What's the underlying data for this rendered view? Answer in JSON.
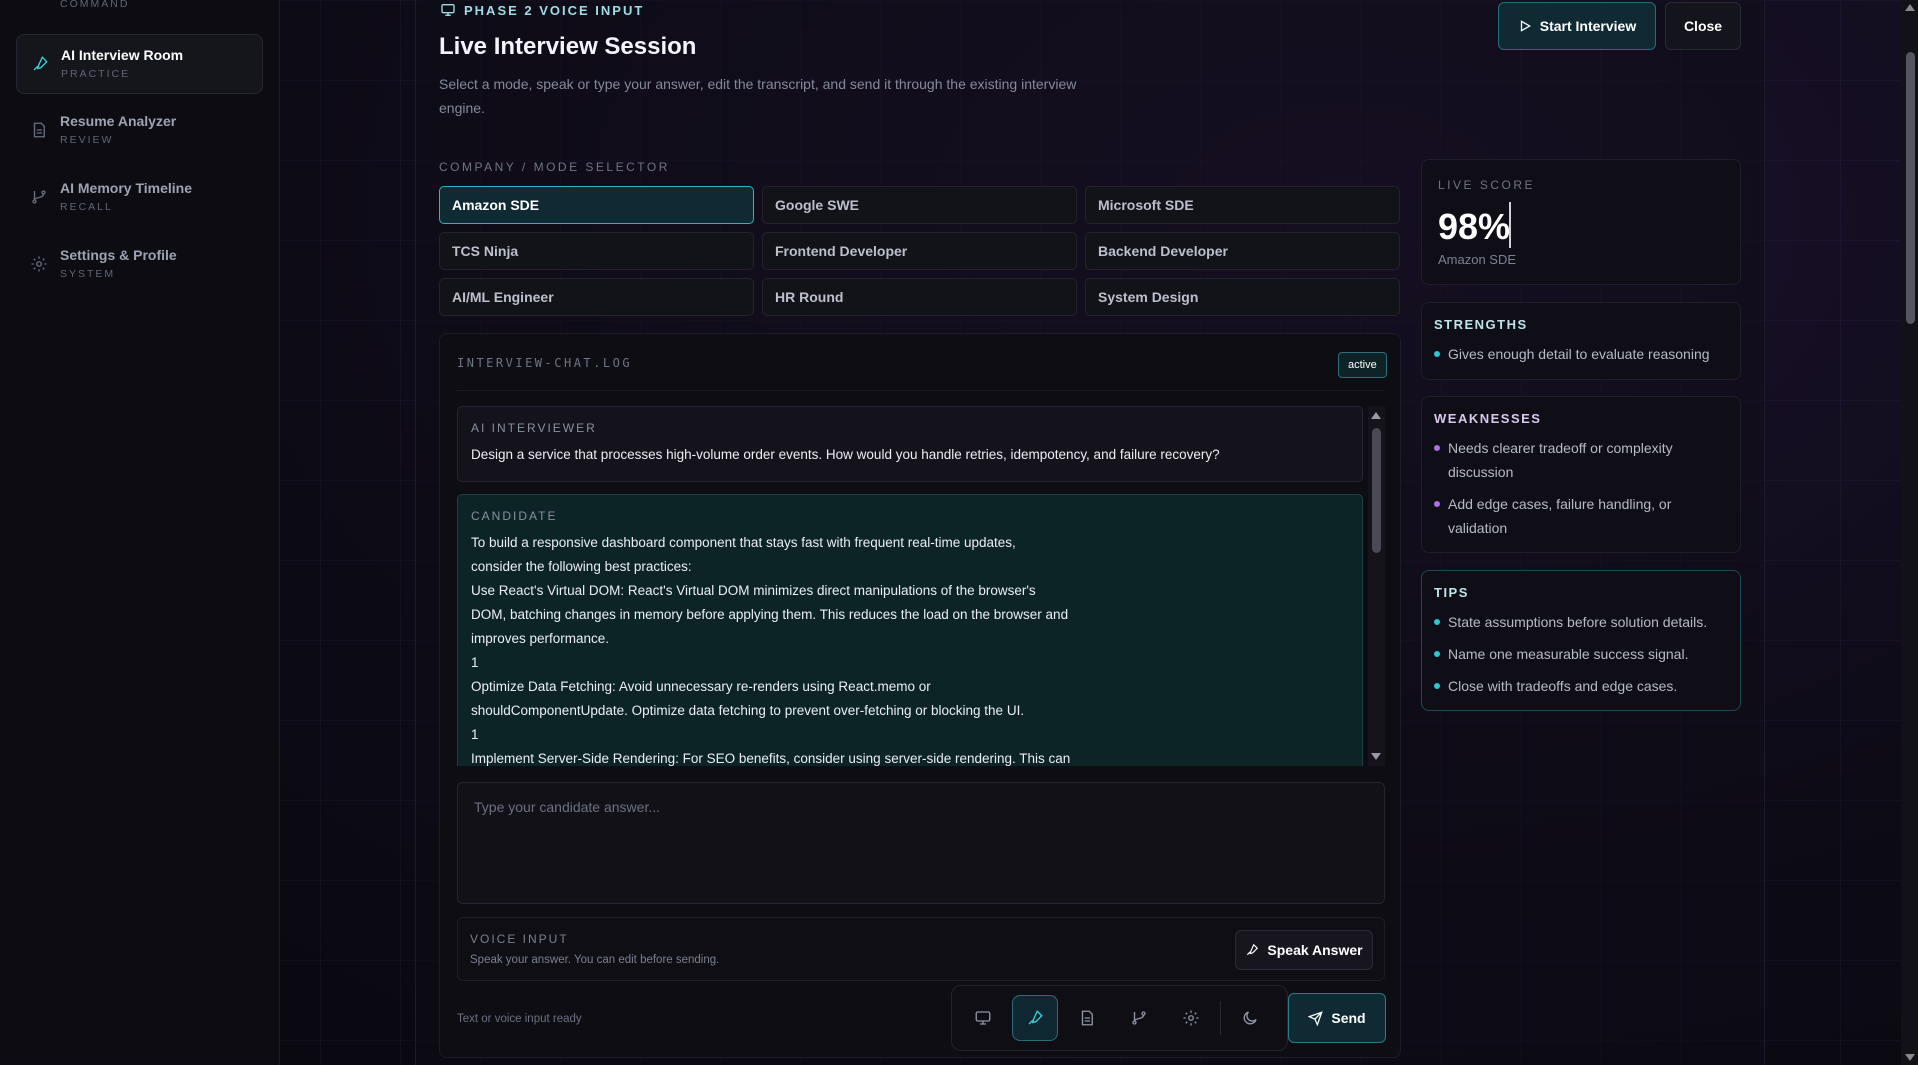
{
  "sidebar": {
    "items": [
      {
        "label": "",
        "sub": "COMMAND"
      },
      {
        "label": "AI Interview Room",
        "sub": "PRACTICE"
      },
      {
        "label": "Resume Analyzer",
        "sub": "REVIEW"
      },
      {
        "label": "AI Memory Timeline",
        "sub": "RECALL"
      },
      {
        "label": "Settings & Profile",
        "sub": "SYSTEM"
      }
    ]
  },
  "header": {
    "phase": "PHASE 2 VOICE INPUT",
    "title": "Live Interview Session",
    "subtitle": "Select a mode, speak or type your answer, edit the transcript, and send it through the existing interview engine.",
    "start_label": "Start Interview",
    "close_label": "Close"
  },
  "modes": {
    "label": "COMPANY / MODE SELECTOR",
    "selected": "Amazon SDE",
    "options": [
      "Amazon SDE",
      "Google SWE",
      "Microsoft SDE",
      "TCS Ninja",
      "Frontend Developer",
      "Backend Developer",
      "AI/ML Engineer",
      "HR Round",
      "System Design"
    ]
  },
  "chat": {
    "log_title": "INTERVIEW-CHAT.LOG",
    "status_badge": "active",
    "messages": [
      {
        "role": "AI INTERVIEWER",
        "text": "Design a service that processes high-volume order events. How would you handle retries, idempotency, and failure recovery?"
      },
      {
        "role": "CANDIDATE",
        "text": "To build a responsive dashboard component that stays fast with frequent real-time updates,\nconsider the following best practices:\nUse React's Virtual DOM: React's Virtual DOM minimizes direct manipulations of the browser's\nDOM, batching changes in memory before applying them. This reduces the load on the browser and\nimproves performance.\n1\nOptimize Data Fetching: Avoid unnecessary re-renders using React.memo or\nshouldComponentUpdate. Optimize data fetching to prevent over-fetching or blocking the UI.\n1\nImplement Server-Side Rendering: For SEO benefits, consider using server-side rendering. This can"
      }
    ],
    "answer_placeholder": "Type your candidate answer...",
    "voice_title": "VOICE INPUT",
    "voice_sub": "Speak your answer. You can edit before sending.",
    "speak_label": "Speak Answer",
    "status_text": "Text or voice input ready",
    "send_label": "Send"
  },
  "score": {
    "label": "LIVE SCORE",
    "value": "98%",
    "mode": "Amazon SDE"
  },
  "strengths": {
    "title": "STRENGTHS",
    "items": [
      "Gives enough detail to evaluate reasoning"
    ]
  },
  "weaknesses": {
    "title": "WEAKNESSES",
    "items": [
      "Needs clearer tradeoff or complexity discussion",
      "Add edge cases, failure handling, or validation"
    ]
  },
  "tips": {
    "title": "TIPS",
    "items": [
      "State assumptions before solution details.",
      "Name one measurable success signal.",
      "Close with tradeoffs and edge cases."
    ]
  },
  "colors": {
    "accent_cyan": "#2bb6c4",
    "accent_violet": "#b06ee0",
    "background": "#0b0a12"
  },
  "dock": {
    "icons": [
      "monitor-icon",
      "microphone-icon",
      "document-icon",
      "git-branch-icon",
      "gear-icon",
      "moon-icon"
    ]
  }
}
